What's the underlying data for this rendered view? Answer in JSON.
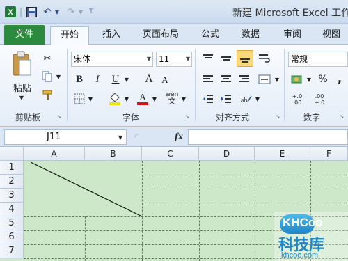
{
  "app": {
    "title": "新建 Microsoft Excel 工作"
  },
  "qat": {
    "undo": "↶",
    "redo": "↷"
  },
  "tabs": [
    {
      "label": "文件"
    },
    {
      "label": "开始"
    },
    {
      "label": "插入"
    },
    {
      "label": "页面布局"
    },
    {
      "label": "公式"
    },
    {
      "label": "数据"
    },
    {
      "label": "审阅"
    },
    {
      "label": "视图"
    }
  ],
  "ribbon": {
    "clipboard": {
      "paste_label": "粘贴",
      "group_label": "剪贴板"
    },
    "font": {
      "family": "宋体",
      "size": "11",
      "bold": "B",
      "italic": "I",
      "underline": "U",
      "grow": "A",
      "shrink": "A",
      "wen": "wén",
      "group_label": "字体"
    },
    "alignment": {
      "group_label": "对齐方式"
    },
    "number": {
      "format": "常规",
      "percent": "%",
      "comma": ",",
      "inc_decimal": "+.0 .00",
      "dec_decimal": ".00 +.0",
      "group_label": "数字"
    }
  },
  "formula_bar": {
    "name_box": "J11",
    "fx": "fx"
  },
  "sheet": {
    "columns": [
      "A",
      "B",
      "C",
      "D",
      "E",
      "F"
    ],
    "rows": [
      "1",
      "2",
      "3",
      "4",
      "5",
      "6",
      "7"
    ],
    "selection_color": "#cde8c8"
  },
  "watermark": {
    "logo": "KHCoo",
    "cn": "科技库",
    "url": "khcoo.com"
  }
}
